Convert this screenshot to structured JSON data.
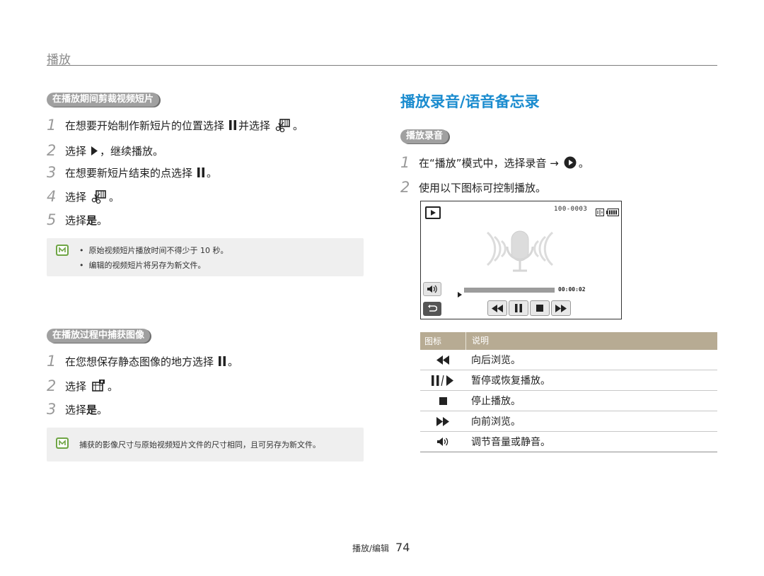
{
  "header": {
    "title": "播放"
  },
  "left": {
    "trim": {
      "heading": "在播放期间剪裁视频短片",
      "steps": [
        {
          "num": "1",
          "pre": "在想要开始制作新短片的位置选择",
          "mid": "并选择",
          "post": "。"
        },
        {
          "num": "2",
          "pre": "选择",
          "post": "，继续播放。"
        },
        {
          "num": "3",
          "pre": "在想要新短片结束的点选择",
          "post": "。"
        },
        {
          "num": "4",
          "pre": "选择",
          "post": "。"
        },
        {
          "num": "5",
          "pre": "选择",
          "bold": "是",
          "post": "。"
        }
      ],
      "notes": [
        "原始视频短片播放时间不得少于 10 秒。",
        "编辑的视频短片将另存为新文件。"
      ]
    },
    "capture": {
      "heading": "在播放过程中捕获图像",
      "steps": [
        {
          "num": "1",
          "pre": "在您想保存静态图像的地方选择",
          "post": "。"
        },
        {
          "num": "2",
          "pre": "选择",
          "post": "。"
        },
        {
          "num": "3",
          "pre": "选择",
          "bold": "是",
          "post": "。"
        }
      ],
      "note": "捕获的影像尺寸与原始视频短片文件的尺寸相同，且可另存为新文件。"
    }
  },
  "right": {
    "title": "播放录音/语音备忘录",
    "pill": "播放录音",
    "steps": [
      {
        "num": "1",
        "pre": "在“播放”模式中，选择录音 →",
        "post": "。"
      },
      {
        "num": "2",
        "pre": "使用以下图标可控制播放。"
      }
    ],
    "screen": {
      "file_no": "100-0003",
      "time": "00:00:02",
      "progress": 1.0
    },
    "table": {
      "headers": [
        "图标",
        "说明"
      ],
      "rows": [
        {
          "icon": "rewind-icon",
          "desc": "向后浏览。"
        },
        {
          "icon": "pause-play-icon",
          "desc": "暂停或恢复播放。"
        },
        {
          "icon": "stop-icon",
          "desc": "停止播放。"
        },
        {
          "icon": "fast-forward-icon",
          "desc": "向前浏览。"
        },
        {
          "icon": "volume-icon",
          "desc": "调节音量或静音。"
        }
      ]
    }
  },
  "footer": {
    "section": "播放/编辑",
    "page": "74"
  }
}
